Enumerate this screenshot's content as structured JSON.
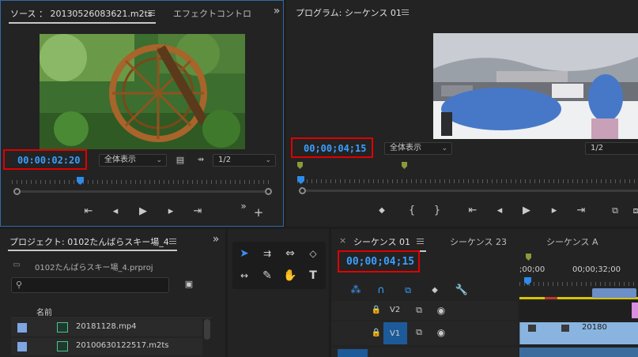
{
  "source": {
    "tab_title": "ソース ： 20130526083621.m2ts",
    "tab_effect": "エフェクトコントロ",
    "timecode": "00:00:02:20",
    "fit": "全体表示",
    "resolution": "1/2"
  },
  "program": {
    "tab_title": "プログラム: シーケンス 01",
    "timecode": "00;00;04;15",
    "fit": "全体表示",
    "resolution": "1/2"
  },
  "project": {
    "tab_title": "プロジェクト: 0102たんばらスキー場_4",
    "file_name": "0102たんばらスキー場_4.prproj",
    "search_placeholder": "",
    "column_name": "名前",
    "items": [
      {
        "name": "20181128.mp4"
      },
      {
        "name": "20100630122517.m2ts"
      }
    ]
  },
  "timeline": {
    "tabs": [
      "シーケンス 01",
      "シーケンス 23",
      "シーケンス A"
    ],
    "close": "×",
    "timecode": "00;00;04;15",
    "ruler_labels": [
      ";00;00",
      "00;00;32;00"
    ],
    "tracks": [
      {
        "name": "V2"
      },
      {
        "name": "V1"
      }
    ],
    "clip_label": "20180"
  },
  "icons": {
    "more": "»",
    "add": "+"
  },
  "colors": {
    "accent": "#2d8ceb",
    "timecode": "#3aa0ff",
    "highlight_box": "#e00000",
    "clip": "#8ab4e0"
  }
}
